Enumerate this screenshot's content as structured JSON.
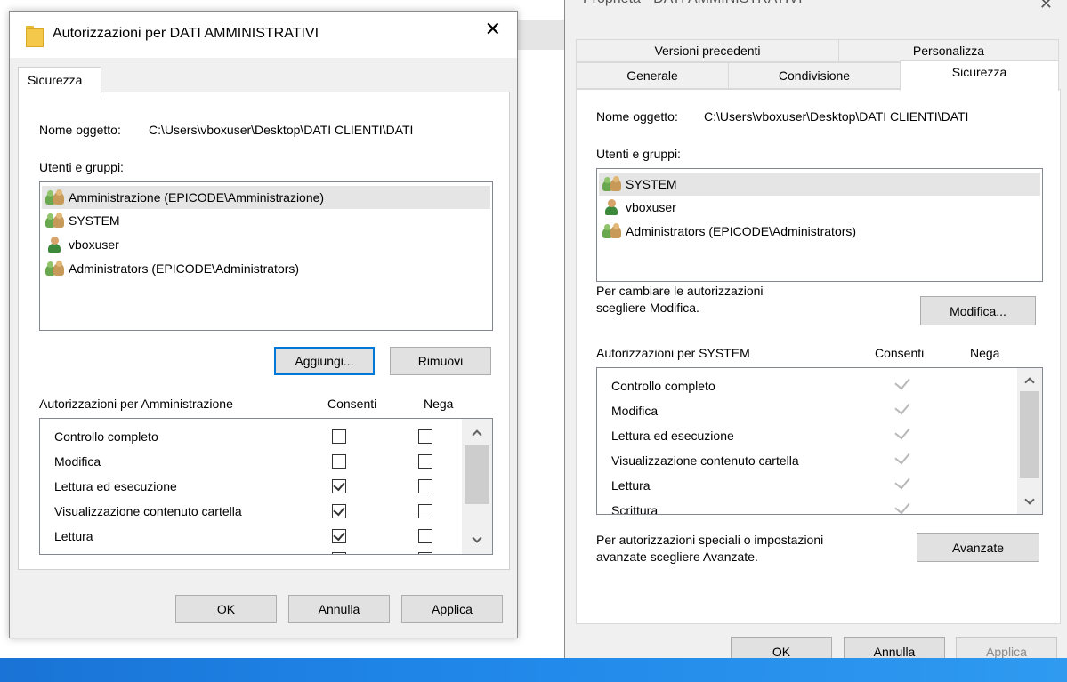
{
  "left_dialog": {
    "title": "Autorizzazioni per DATI AMMINISTRATIVI",
    "close_glyph": "✕",
    "tab": "Sicurezza",
    "object_label": "Nome oggetto:",
    "object_path": "C:\\Users\\vboxuser\\Desktop\\DATI CLIENTI\\DATI",
    "users_label": "Utenti e gruppi:",
    "users": [
      {
        "name": "Amministrazione (EPICODE\\Amministrazione)",
        "icon": "group-icon",
        "selected": true
      },
      {
        "name": "SYSTEM",
        "icon": "group-icon",
        "selected": false
      },
      {
        "name": "vboxuser",
        "icon": "user-icon",
        "selected": false
      },
      {
        "name": "Administrators (EPICODE\\Administrators)",
        "icon": "group-icon",
        "selected": false
      }
    ],
    "add_button": "Aggiungi...",
    "remove_button": "Rimuovi",
    "perm_header": "Autorizzazioni per Amministrazione",
    "allow_header": "Consenti",
    "deny_header": "Nega",
    "permissions": [
      {
        "name": "Controllo completo",
        "allow": false,
        "deny": false
      },
      {
        "name": "Modifica",
        "allow": false,
        "deny": false
      },
      {
        "name": "Lettura ed esecuzione",
        "allow": true,
        "deny": false
      },
      {
        "name": "Visualizzazione contenuto cartella",
        "allow": true,
        "deny": false
      },
      {
        "name": "Lettura",
        "allow": true,
        "deny": false
      }
    ],
    "ok_button": "OK",
    "cancel_button": "Annulla",
    "apply_button": "Applica"
  },
  "right_dialog": {
    "title_partial": "Proprietà - DATI AMMINISTRATIVI",
    "tabs_row1": [
      "Versioni precedenti",
      "Personalizza"
    ],
    "tabs_row2": [
      "Generale",
      "Condivisione",
      "Sicurezza"
    ],
    "object_label": "Nome oggetto:",
    "object_path": "C:\\Users\\vboxuser\\Desktop\\DATI CLIENTI\\DATI",
    "users_label": "Utenti e gruppi:",
    "users": [
      {
        "name": "SYSTEM",
        "icon": "group-icon",
        "selected": true
      },
      {
        "name": "vboxuser",
        "icon": "user-icon",
        "selected": false
      },
      {
        "name": "Administrators (EPICODE\\Administrators)",
        "icon": "group-icon",
        "selected": false
      }
    ],
    "change_text_1": "Per cambiare le autorizzazioni",
    "change_text_2": "scegliere Modifica.",
    "edit_button": "Modifica...",
    "perm_header": "Autorizzazioni per SYSTEM",
    "allow_header": "Consenti",
    "deny_header": "Nega",
    "permissions": [
      {
        "name": "Controllo completo",
        "allow": true
      },
      {
        "name": "Modifica",
        "allow": true
      },
      {
        "name": "Lettura ed esecuzione",
        "allow": true
      },
      {
        "name": "Visualizzazione contenuto cartella",
        "allow": true
      },
      {
        "name": "Lettura",
        "allow": true
      },
      {
        "name": "Scrittura",
        "allow": true
      }
    ],
    "advanced_text_1": "Per autorizzazioni speciali o impostazioni",
    "advanced_text_2": "avanzate scegliere Avanzate.",
    "advanced_button": "Avanzate",
    "ok_button": "OK",
    "cancel_button": "Annulla",
    "apply_button": "Applica"
  },
  "colors": {
    "accent_focus": "#0078d7",
    "taskbar": "#1f86e8",
    "selection": "#e5e5e5"
  }
}
